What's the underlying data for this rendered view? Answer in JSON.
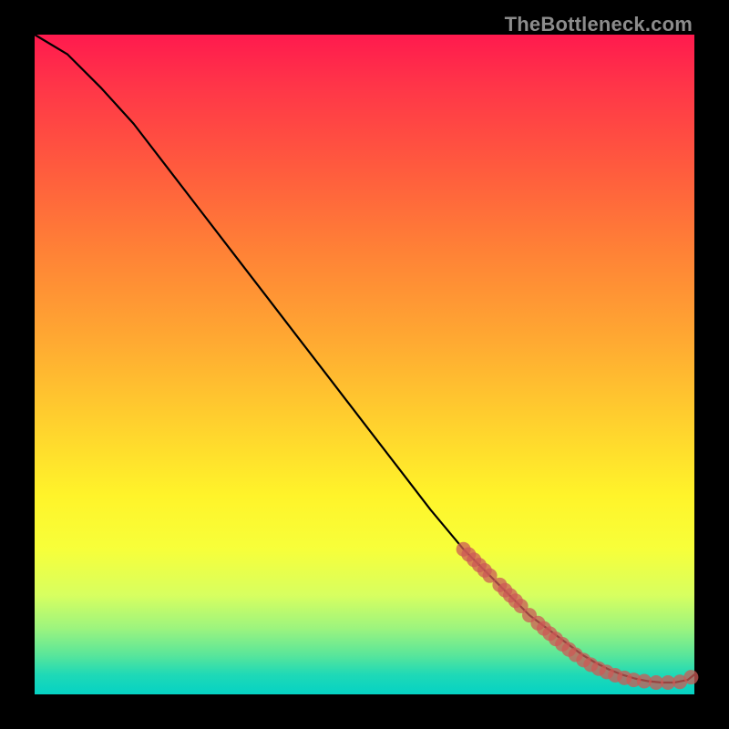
{
  "watermark": "TheBottleneck.com",
  "chart_data": {
    "type": "line",
    "title": "",
    "xlabel": "",
    "ylabel": "",
    "xlim": [
      0,
      100
    ],
    "ylim": [
      0,
      100
    ],
    "grid": false,
    "legend": false,
    "background_gradient": [
      "#ff1a4e",
      "#ff8236",
      "#fff42a",
      "#1fd9b6"
    ],
    "series": [
      {
        "name": "curve",
        "color": "#000000",
        "x": [
          0,
          5,
          10,
          15,
          20,
          25,
          30,
          35,
          40,
          45,
          50,
          55,
          60,
          65,
          70,
          73,
          75,
          77,
          79,
          81,
          83,
          85,
          87,
          89,
          91,
          93,
          95,
          97,
          99,
          100
        ],
        "y": [
          100,
          97,
          92,
          86.5,
          80,
          73.5,
          67,
          60.5,
          54,
          47.5,
          41,
          34.5,
          28,
          22,
          17,
          14,
          12,
          10.5,
          9,
          7.5,
          6,
          4.8,
          3.8,
          3.0,
          2.4,
          2.0,
          1.8,
          1.8,
          2.2,
          3
        ]
      }
    ],
    "scatter": [
      {
        "name": "markers",
        "color": "#cc5a55",
        "radius": 8,
        "points": [
          {
            "x": 65.0,
            "y": 22.0
          },
          {
            "x": 65.8,
            "y": 21.2
          },
          {
            "x": 66.6,
            "y": 20.4
          },
          {
            "x": 67.4,
            "y": 19.6
          },
          {
            "x": 68.2,
            "y": 18.8
          },
          {
            "x": 69.0,
            "y": 18.0
          },
          {
            "x": 70.5,
            "y": 16.6
          },
          {
            "x": 71.3,
            "y": 15.8
          },
          {
            "x": 72.1,
            "y": 15.0
          },
          {
            "x": 72.9,
            "y": 14.2
          },
          {
            "x": 73.7,
            "y": 13.4
          },
          {
            "x": 75.0,
            "y": 12.0
          },
          {
            "x": 76.3,
            "y": 10.8
          },
          {
            "x": 77.2,
            "y": 10.0
          },
          {
            "x": 78.1,
            "y": 9.2
          },
          {
            "x": 79.0,
            "y": 8.4
          },
          {
            "x": 80.0,
            "y": 7.6
          },
          {
            "x": 81.0,
            "y": 6.8
          },
          {
            "x": 82.0,
            "y": 6.0
          },
          {
            "x": 83.2,
            "y": 5.2
          },
          {
            "x": 84.3,
            "y": 4.5
          },
          {
            "x": 85.5,
            "y": 3.9
          },
          {
            "x": 86.7,
            "y": 3.4
          },
          {
            "x": 88.0,
            "y": 2.9
          },
          {
            "x": 89.4,
            "y": 2.5
          },
          {
            "x": 90.8,
            "y": 2.2
          },
          {
            "x": 92.4,
            "y": 2.0
          },
          {
            "x": 94.2,
            "y": 1.8
          },
          {
            "x": 96.0,
            "y": 1.8
          },
          {
            "x": 97.8,
            "y": 1.9
          },
          {
            "x": 99.5,
            "y": 2.6
          }
        ]
      }
    ]
  }
}
